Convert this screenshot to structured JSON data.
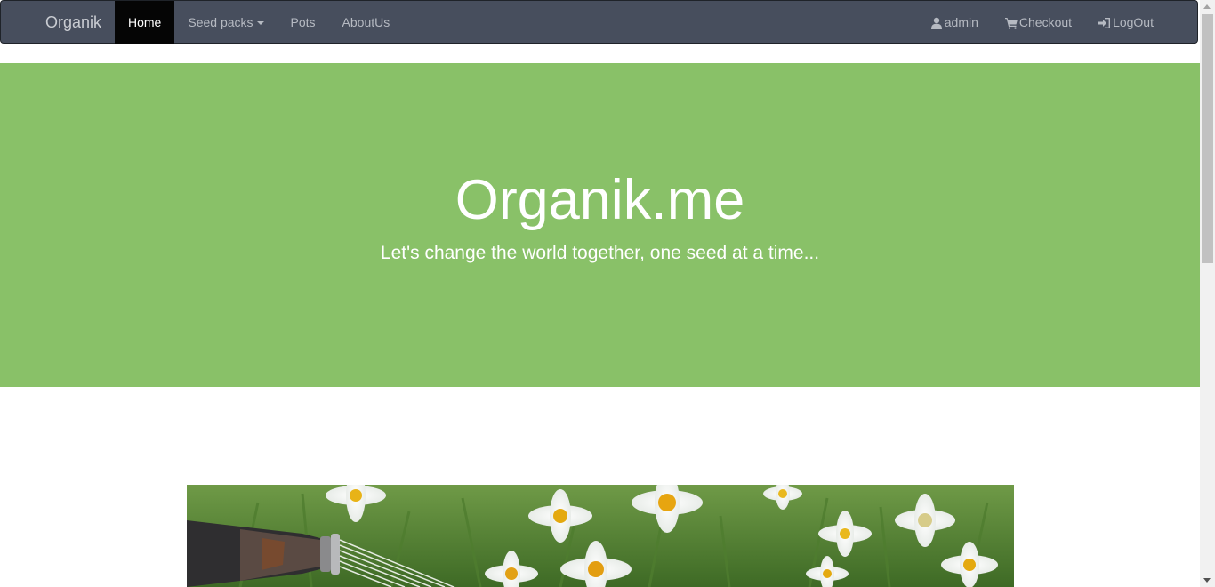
{
  "navbar": {
    "brand": "Organik",
    "left_items": [
      {
        "label": "Home",
        "active": true
      },
      {
        "label": "Seed packs",
        "dropdown": true
      },
      {
        "label": "Pots"
      },
      {
        "label": "AboutUs"
      }
    ],
    "right_items": [
      {
        "label": "admin",
        "icon": "user-icon"
      },
      {
        "label": "Checkout",
        "icon": "cart-icon"
      },
      {
        "label": "LogOut",
        "icon": "log-out-icon"
      }
    ]
  },
  "hero": {
    "title": "Organik.me",
    "subtitle": "Let's change the world together, one seed at a time..."
  },
  "banner": {
    "image": "watering-can-daisies-photo"
  },
  "colors": {
    "navbar_bg": "#474e5d",
    "active_bg": "#050505",
    "hero_bg": "#89c168",
    "text_light": "#ffffff",
    "nav_text": "#b6bac2"
  }
}
